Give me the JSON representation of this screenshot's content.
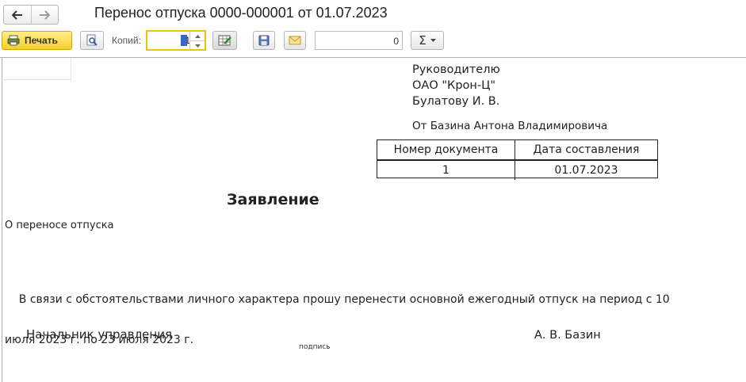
{
  "window": {
    "title": "Перенос отпуска 0000-000001 от 01.07.2023",
    "back_icon": "arrow-left-icon",
    "forward_icon": "arrow-right-icon"
  },
  "toolbar": {
    "print_label": "Печать",
    "copies_label": "Копий:",
    "copies_value": "1",
    "number_value": "0",
    "sum_symbol": "Σ"
  },
  "document": {
    "addressee": {
      "line1": "Руководителю",
      "line2": "ОАО \"Крон-Ц\"",
      "line3": "Булатову И. В."
    },
    "from": "От Базина Антона Владимировича",
    "table": {
      "headers": [
        "Номер документа",
        "Дата составления"
      ],
      "rows": [
        [
          "1",
          "01.07.2023"
        ]
      ]
    },
    "heading": "Заявление",
    "subject": "О переносе отпуска",
    "body_line1": "    В связи с обстоятельствами личного характера прошу перенести основной ежегодный отпуск на период с 10",
    "body_line2": "июля 2023 г. по 23 июля 2023 г.",
    "position": "Начальник управления",
    "signature_label": "подпись",
    "signer": "А. В. Базин"
  },
  "colors": {
    "print_button": "#f6cf2a",
    "copies_border": "#f3c200",
    "caret": "#3b66c4"
  }
}
